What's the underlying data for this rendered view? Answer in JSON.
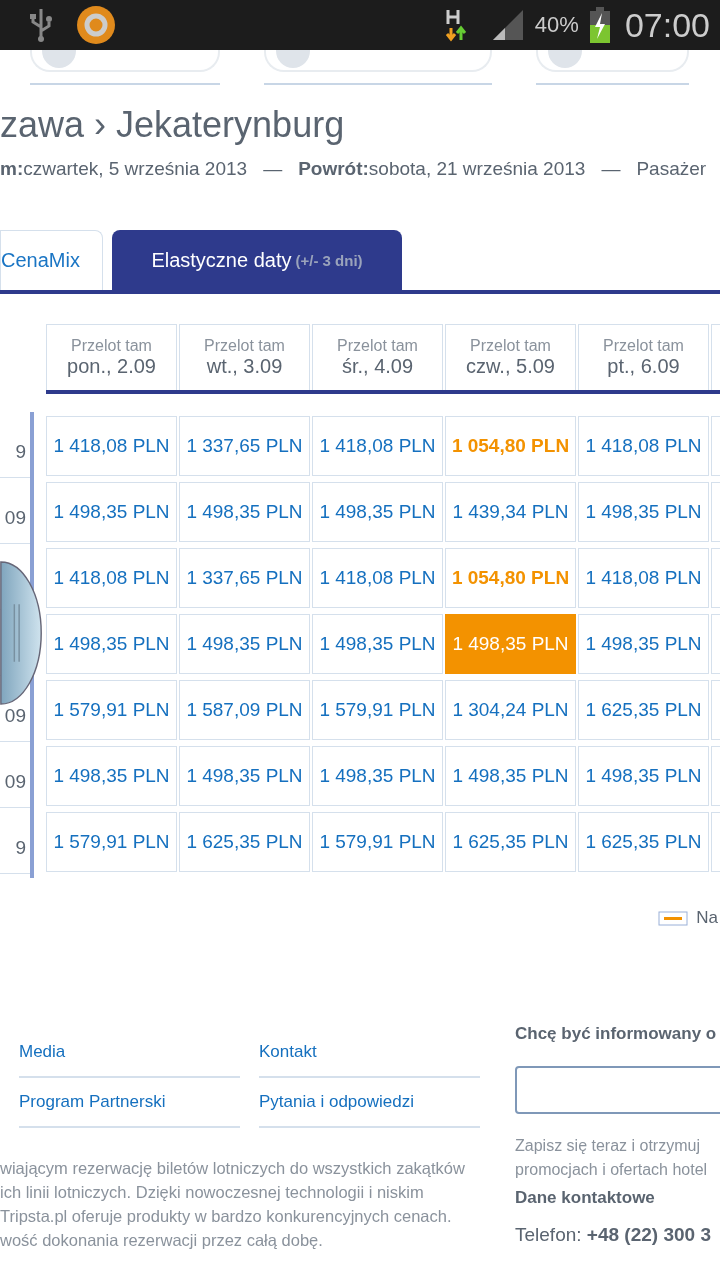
{
  "status_bar": {
    "battery": "40%",
    "time": "07:00"
  },
  "title": "zawa › Jekaterynburg",
  "trip": [
    {
      "label": "m:",
      "value": "czwartek, 5 września 2013"
    },
    {
      "separator": "—",
      "label": "Powrót:",
      "value": "sobota, 21 września 2013"
    },
    {
      "separator": "—",
      "value": "Pasażer"
    }
  ],
  "tabs": [
    {
      "label": "CenaMix",
      "selected": false
    },
    {
      "label": "Elastyczne daty",
      "note": "(+/- 3 dni)",
      "selected": true
    }
  ],
  "columns": [
    {
      "top": "Przelot tam",
      "date": "pon., 2.09"
    },
    {
      "top": "Przelot tam",
      "date": "wt., 3.09"
    },
    {
      "top": "Przelot tam",
      "date": "śr., 4.09"
    },
    {
      "top": "Przelot tam",
      "date": "czw., 5.09"
    },
    {
      "top": "Przelot tam",
      "date": "pt., 6.09"
    }
  ],
  "rows": [
    {
      "label": "9",
      "cells": [
        {
          "price": "1 418,08 PLN",
          "lowest": false,
          "selected": false
        },
        {
          "price": "1 337,65 PLN",
          "lowest": false,
          "selected": false
        },
        {
          "price": "1 418,08 PLN",
          "lowest": false,
          "selected": false
        },
        {
          "price": "1 054,80 PLN",
          "lowest": true,
          "selected": false
        },
        {
          "price": "1 418,08 PLN",
          "lowest": false,
          "selected": false
        }
      ]
    },
    {
      "label": "09",
      "cells": [
        {
          "price": "1 498,35 PLN",
          "lowest": false,
          "selected": false
        },
        {
          "price": "1 498,35 PLN",
          "lowest": false,
          "selected": false
        },
        {
          "price": "1 498,35 PLN",
          "lowest": false,
          "selected": false
        },
        {
          "price": "1 439,34 PLN",
          "lowest": false,
          "selected": false
        },
        {
          "price": "1 498,35 PLN",
          "lowest": false,
          "selected": false
        }
      ]
    },
    {
      "cells": [
        {
          "price": "1 418,08 PLN",
          "lowest": false,
          "selected": false
        },
        {
          "price": "1 337,65 PLN",
          "lowest": false,
          "selected": false
        },
        {
          "price": "1 418,08 PLN",
          "lowest": false,
          "selected": false
        },
        {
          "price": "1 054,80 PLN",
          "lowest": true,
          "selected": false
        },
        {
          "price": "1 418,08 PLN",
          "lowest": false,
          "selected": false
        }
      ]
    },
    {
      "cells": [
        {
          "price": "1 498,35 PLN",
          "lowest": false,
          "selected": false
        },
        {
          "price": "1 498,35 PLN",
          "lowest": false,
          "selected": false
        },
        {
          "price": "1 498,35 PLN",
          "lowest": false,
          "selected": false
        },
        {
          "price": "1 498,35 PLN",
          "lowest": false,
          "selected": true
        },
        {
          "price": "1 498,35 PLN",
          "lowest": false,
          "selected": false
        }
      ]
    },
    {
      "label": "09",
      "cells": [
        {
          "price": "1 579,91 PLN",
          "lowest": false,
          "selected": false
        },
        {
          "price": "1 587,09 PLN",
          "lowest": false,
          "selected": false
        },
        {
          "price": "1 579,91 PLN",
          "lowest": false,
          "selected": false
        },
        {
          "price": "1 304,24 PLN",
          "lowest": false,
          "selected": false
        },
        {
          "price": "1 625,35 PLN",
          "lowest": false,
          "selected": false
        }
      ]
    },
    {
      "label": "09",
      "cells": [
        {
          "price": "1 498,35 PLN",
          "lowest": false,
          "selected": false
        },
        {
          "price": "1 498,35 PLN",
          "lowest": false,
          "selected": false
        },
        {
          "price": "1 498,35 PLN",
          "lowest": false,
          "selected": false
        },
        {
          "price": "1 498,35 PLN",
          "lowest": false,
          "selected": false
        },
        {
          "price": "1 498,35 PLN",
          "lowest": false,
          "selected": false
        }
      ]
    },
    {
      "label": "9",
      "cells": [
        {
          "price": "1 579,91 PLN",
          "lowest": false,
          "selected": false
        },
        {
          "price": "1 625,35 PLN",
          "lowest": false,
          "selected": false
        },
        {
          "price": "1 579,91 PLN",
          "lowest": false,
          "selected": false
        },
        {
          "price": "1 625,35 PLN",
          "lowest": false,
          "selected": false
        },
        {
          "price": "1 625,35 PLN",
          "lowest": false,
          "selected": false
        }
      ]
    }
  ],
  "legend": {
    "label": "Na"
  },
  "footer_links": [
    [
      "Media",
      "Program Partnerski"
    ],
    [
      "Kontakt",
      "Pytania i odpowiedzi"
    ]
  ],
  "about_lines": [
    "wiającym rezerwację biletów lotniczych do wszystkich zakątków",
    "ich linii lotniczych. Dzięki nowoczesnej technologii i niskim",
    "Tripsta.pl oferuje produkty w bardzo konkurencyjnych cenach.",
    "wość dokonania rezerwacji przez całą dobę."
  ],
  "newsletter": {
    "heading": "Chcę być informowany o",
    "lines": [
      "Zapisz się teraz i otrzymuj",
      "promocjach i ofertach hotel"
    ]
  },
  "contact": {
    "heading": "Dane kontaktowe",
    "phone_label": "Telefon:",
    "phone": "+48 (22) 300 3"
  }
}
